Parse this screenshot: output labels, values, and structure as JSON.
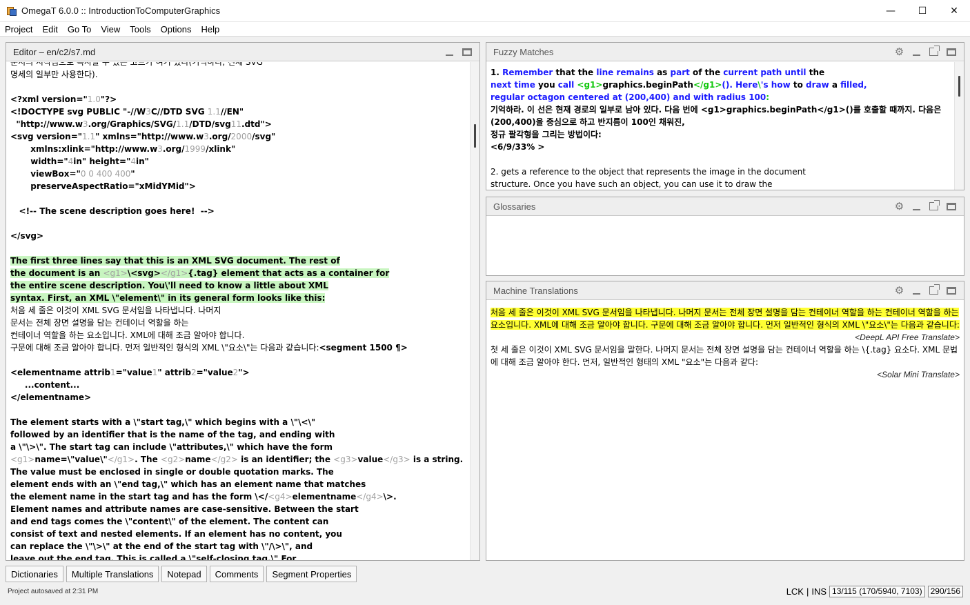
{
  "window": {
    "title": "OmegaT 6.0.0 :: IntroductionToComputerGraphics",
    "minimize": "—",
    "maximize": "☐",
    "close": "✕"
  },
  "menu": [
    "Project",
    "Edit",
    "Go To",
    "View",
    "Tools",
    "Options",
    "Help"
  ],
  "editor": {
    "title": "Editor – en/c2/s7.md"
  },
  "fuzzy": {
    "title": "Fuzzy Matches",
    "line4": "기억하라. 이 선은 현재 경로의 일부로 남아 있다. 다음 번에 <g1>graphics.beginPath</g1>()를 호출할 때까지. 다음은",
    "line5": "(200,400)을 중심으로 하고 반지름이 100인 채워진,",
    "line6": "정규 팔각형을 그리는 방법이다:",
    "line7": "<6/9/33% >",
    "line9": "2. gets a reference to the object that represents the image in the document",
    "line10": "structure. Once you have such an object, you can use it to draw the"
  },
  "glossaries": {
    "title": "Glossaries"
  },
  "mt": {
    "title": "Machine Translations",
    "deepl_text": "처음 세 줄은 이것이 XML SVG 문서임을 나타냅니다. 나머지 문서는 전체 장면 설명을 담는 컨테이너 역할을 하는 컨테이너 역할을 하는 요소입니다. XML에 대해 조금 알아야 합니다. 구문에 대해 조금 알아야 합니다. 먼저 일반적인 형식의 XML \\\"요소\\\"는 다음과 같습니다:",
    "deepl_source": "<DeepL API Free Translate>",
    "solar_text": "첫 세 줄은 이것이 XML SVG 문서임을 말한다. 나머지 문서는 전체 장면 설명을 담는 컨테이너 역할을 하는 \\{.tag} 요소다. XML 문법에 대해 조금 알아야 한다. 먼저, 일반적인 형태의 XML \"요소\"는 다음과 같다:",
    "solar_source": "<Solar Mini Translate>"
  },
  "tabs": [
    "Dictionaries",
    "Multiple Translations",
    "Notepad",
    "Comments",
    "Segment Properties"
  ],
  "status": {
    "autosave": "Project autosaved at 2:31 PM",
    "lck": "LCK",
    "sep": "|",
    "ins": "INS",
    "progress": "13/115 (170/5940, 7103)",
    "chars": "290/156"
  },
  "colors": {
    "segment_highlight": "#c8f5c0",
    "mt_highlight": "#ffff33",
    "match_blue": "#1a1aff",
    "match_green": "#13c80f",
    "tag_gray": "#a0a0a0"
  }
}
